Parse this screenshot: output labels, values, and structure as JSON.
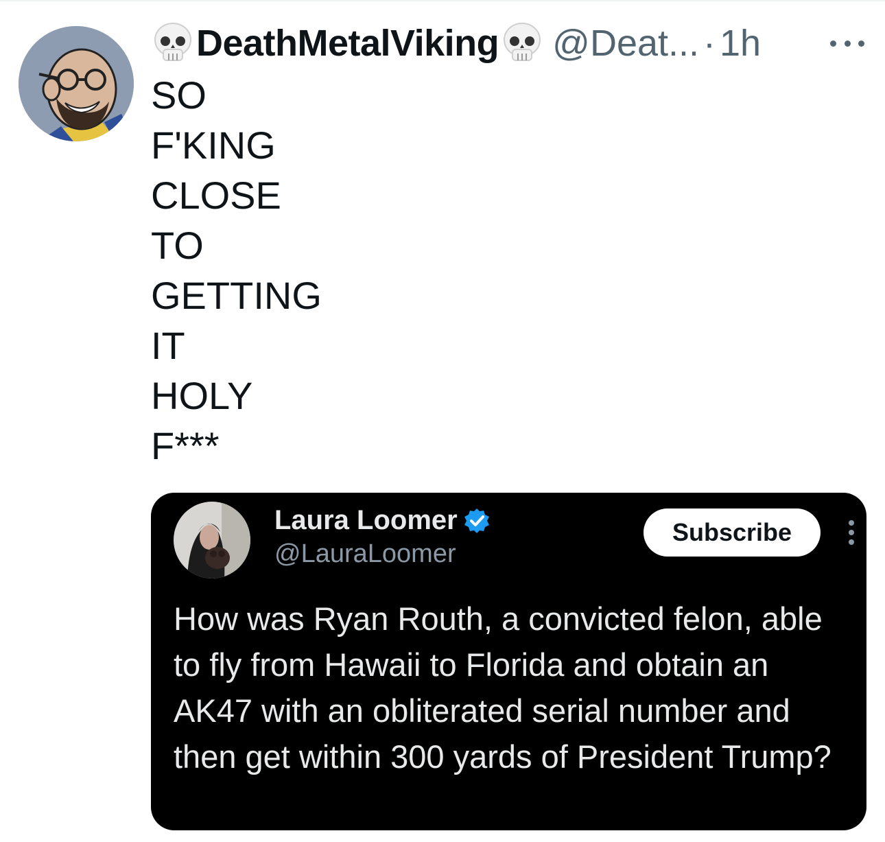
{
  "tweet": {
    "display_name": "DeathMetalViking",
    "name_prefix_emoji": "skull-emoji",
    "name_suffix_emoji": "skull-emoji",
    "handle": "@Deat...",
    "separator": "·",
    "time": "1h",
    "text_lines": [
      "SO",
      "F'KING",
      "CLOSE",
      "TO",
      "GETTING",
      "IT",
      "HOLY",
      "F***"
    ]
  },
  "quoted": {
    "name": "Laura Loomer",
    "verified_color": "#1d9bf0",
    "handle": "@LauraLoomer",
    "subscribe_label": "Subscribe",
    "text": "How was Ryan Routh, a convicted felon, able to fly from Hawaii to Florida and obtain an AK47 with an obliterated serial number and then get within 300 yards of President Trump?"
  },
  "colors": {
    "text_primary": "#0f1419",
    "text_secondary": "#536471",
    "quote_bg": "#000000",
    "quote_text": "#e7e9ea"
  }
}
